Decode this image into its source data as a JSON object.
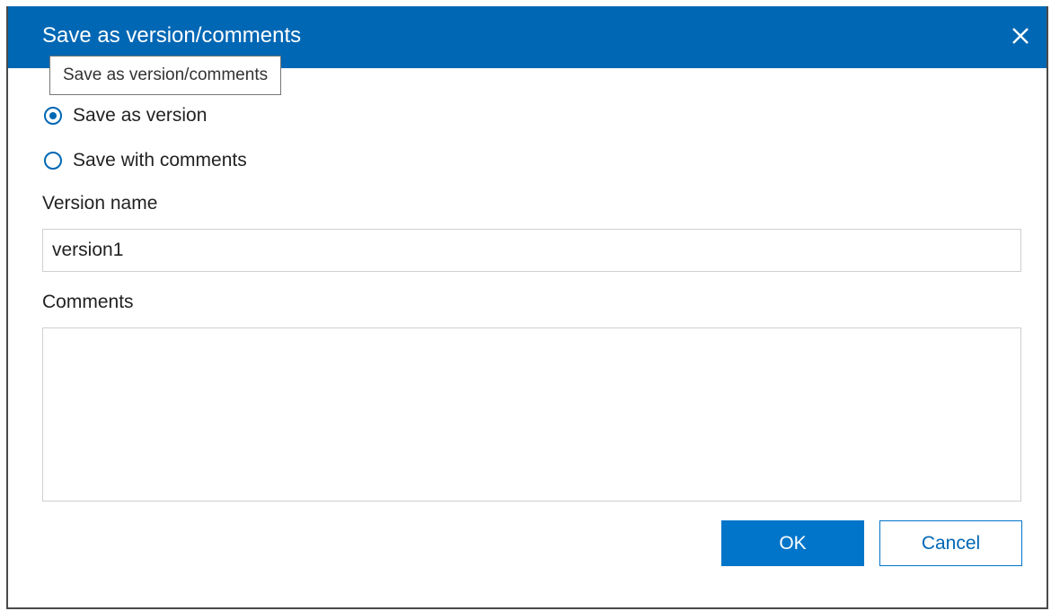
{
  "dialog": {
    "title": "Save as version/comments",
    "close_icon": "close-icon",
    "tooltip": "Save as version/comments"
  },
  "options": [
    {
      "label": "Save as version",
      "checked": true
    },
    {
      "label": "Save with comments",
      "checked": false
    }
  ],
  "version_name": {
    "label": "Version name",
    "value": "version1"
  },
  "comments": {
    "label": "Comments",
    "value": ""
  },
  "buttons": {
    "ok_label": "OK",
    "cancel_label": "Cancel"
  },
  "colors": {
    "titlebar": "#0067b4",
    "primary_button": "#0075c9",
    "radio_accent": "#0067b4"
  }
}
